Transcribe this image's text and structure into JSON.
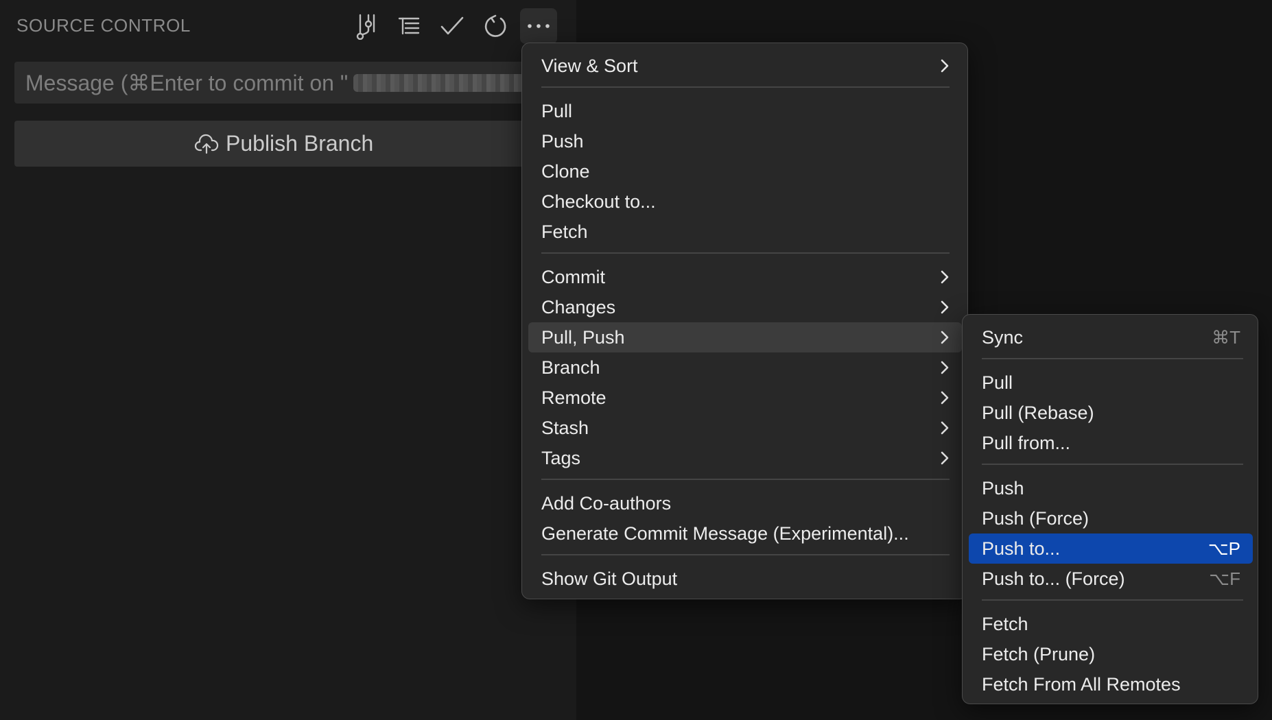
{
  "sidebar": {
    "title": "SOURCE CONTROL",
    "toolbar_icons": [
      "graph-icon",
      "tree-view-icon",
      "checkmark-icon",
      "refresh-icon",
      "more-actions-icon"
    ],
    "commit_message": {
      "placeholder": "Message (⌘Enter to commit on \"",
      "redacted_branch": true
    },
    "publish_button_label": "Publish Branch"
  },
  "main_menu": {
    "items": [
      {
        "label": "View & Sort",
        "submenu": true
      },
      {
        "label": "Pull"
      },
      {
        "label": "Push"
      },
      {
        "label": "Clone"
      },
      {
        "label": "Checkout to..."
      },
      {
        "label": "Fetch"
      },
      {
        "label": "Commit",
        "submenu": true
      },
      {
        "label": "Changes",
        "submenu": true
      },
      {
        "label": "Pull, Push",
        "submenu": true,
        "highlighted": true
      },
      {
        "label": "Branch",
        "submenu": true
      },
      {
        "label": "Remote",
        "submenu": true
      },
      {
        "label": "Stash",
        "submenu": true
      },
      {
        "label": "Tags",
        "submenu": true
      },
      {
        "label": "Add Co-authors"
      },
      {
        "label": "Generate Commit Message (Experimental)..."
      },
      {
        "label": "Show Git Output"
      }
    ]
  },
  "pull_push_submenu": {
    "items": [
      {
        "label": "Sync",
        "shortcut": "⌘T"
      },
      {
        "label": "Pull"
      },
      {
        "label": "Pull (Rebase)"
      },
      {
        "label": "Pull from..."
      },
      {
        "label": "Push"
      },
      {
        "label": "Push (Force)"
      },
      {
        "label": "Push to...",
        "shortcut": "⌥P",
        "selected": true
      },
      {
        "label": "Push to... (Force)",
        "shortcut": "⌥F"
      },
      {
        "label": "Fetch"
      },
      {
        "label": "Fetch (Prune)"
      },
      {
        "label": "Fetch From All Remotes"
      }
    ]
  },
  "colors": {
    "selected_item": "#0d47ad",
    "hover_item": "#3c3c3c",
    "menu_background": "#282828",
    "sidebar_background": "#1b1b1b"
  }
}
